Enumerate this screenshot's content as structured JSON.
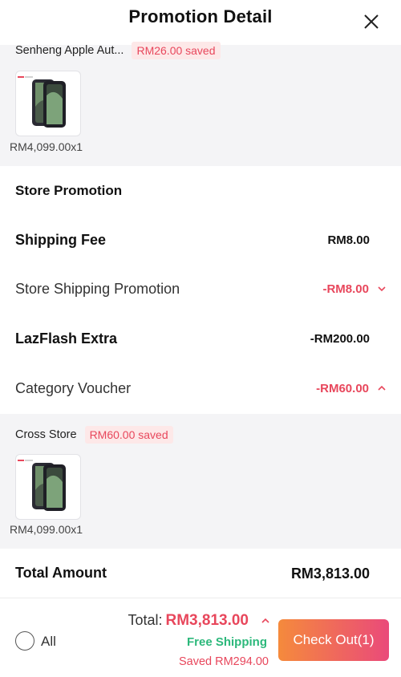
{
  "header": {
    "title": "Promotion Detail",
    "close_icon": "close-icon"
  },
  "store_section": {
    "store_name": "Senheng Apple Aut...",
    "saved_badge": "RM26.00 saved",
    "product_price_qty": "RM4,099.00x1"
  },
  "promotion_rows": {
    "store_promotion": "Store Promotion",
    "shipping_fee_label": "Shipping Fee",
    "shipping_fee_value": "RM8.00",
    "store_shipping_label": "Store Shipping Promotion",
    "store_shipping_value": "-RM8.00",
    "lazflash_label": "LazFlash Extra",
    "lazflash_value": "-RM200.00",
    "category_label": "Category Voucher",
    "category_value": "-RM60.00"
  },
  "cross_store": {
    "label": "Cross Store",
    "saved_badge": "RM60.00 saved",
    "product_price_qty": "RM4,099.00x1"
  },
  "total_amount": {
    "label": "Total Amount",
    "value": "RM3,813.00"
  },
  "footer": {
    "all_label": "All",
    "total_prefix": "Total:",
    "total_value": "RM3,813.00",
    "free_shipping": "Free Shipping",
    "saved_total": "Saved RM294.00",
    "checkout_label": "Check Out(1)"
  },
  "colors": {
    "accent_red": "#e8475c",
    "green": "#2cb87b",
    "checkout_start": "#f58a3c",
    "checkout_end": "#ea4a7a"
  }
}
